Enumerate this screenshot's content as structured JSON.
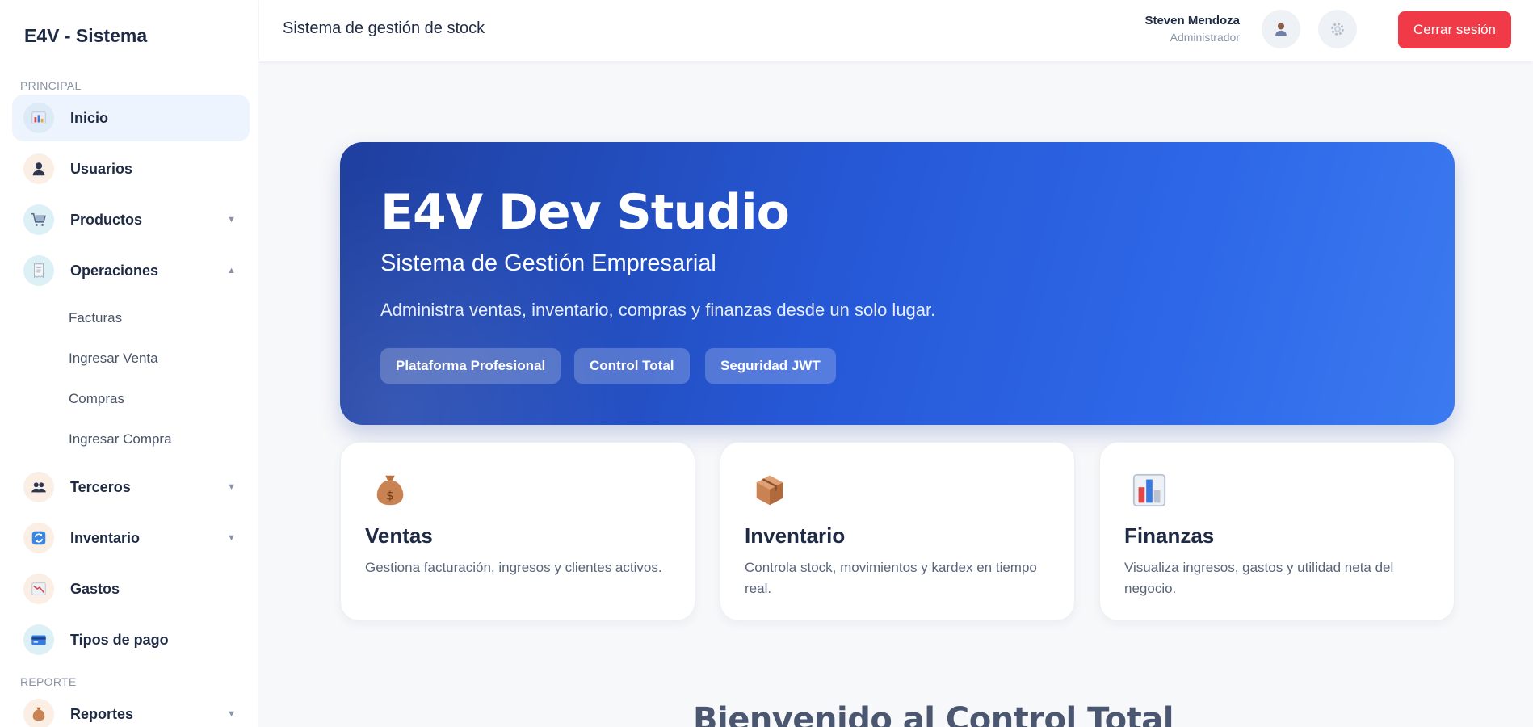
{
  "sidebar": {
    "brand": "E4V - Sistema",
    "section_principal": "PRINCIPAL",
    "section_reporte": "REPORTE",
    "items": [
      {
        "label": "Inicio",
        "icon": "bar-chart-icon"
      },
      {
        "label": "Usuarios",
        "icon": "user-icon"
      },
      {
        "label": "Productos",
        "icon": "shopping-cart-icon"
      },
      {
        "label": "Operaciones",
        "icon": "receipt-icon"
      },
      {
        "label": "Terceros",
        "icon": "users-icon"
      },
      {
        "label": "Inventario",
        "icon": "sync-icon"
      },
      {
        "label": "Gastos",
        "icon": "trend-down-chart-icon"
      },
      {
        "label": "Tipos de pago",
        "icon": "credit-card-icon"
      },
      {
        "label": "Reportes",
        "icon": "money-bag-icon"
      }
    ],
    "operaciones_subitems": [
      "Facturas",
      "Ingresar Venta",
      "Compras",
      "Ingresar Compra"
    ],
    "chevron_down": "▼",
    "chevron_up": "▲"
  },
  "header": {
    "title": "Sistema de gestión de stock",
    "user_name": "Steven Mendoza",
    "user_role": "Administrador",
    "logout_label": "Cerrar sesión"
  },
  "hero": {
    "title": "E4V Dev Studio",
    "subtitle": "Sistema de Gestión Empresarial",
    "description": "Administra ventas, inventario, compras y finanzas desde un solo lugar.",
    "pills": [
      "Plataforma Profesional",
      "Control Total",
      "Seguridad JWT"
    ]
  },
  "cards": [
    {
      "title": "Ventas",
      "description": "Gestiona facturación, ingresos y clientes activos.",
      "icon": "money-bag-icon"
    },
    {
      "title": "Inventario",
      "description": "Controla stock, movimientos y kardex en tiempo real.",
      "icon": "package-icon"
    },
    {
      "title": "Finanzas",
      "description": "Visualiza ingresos, gastos y utilidad neta del negocio.",
      "icon": "bar-chart-icon"
    }
  ],
  "welcome_title": "Bienvenido al Control Total",
  "colors": {
    "accent": "#2658d6",
    "logout": "#f03a48",
    "active_nav": "#eef4fd"
  }
}
